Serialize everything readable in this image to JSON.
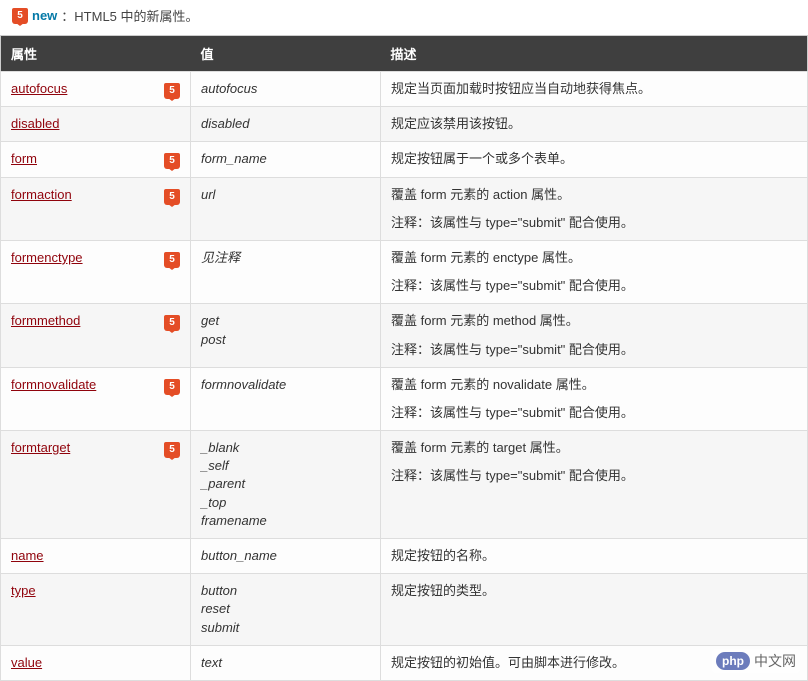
{
  "legend": {
    "badge_glyph": "5",
    "new_label": "new",
    "text": "：HTML5 中的新属性。"
  },
  "table": {
    "headers": {
      "attr": "属性",
      "val": "值",
      "desc": "描述"
    },
    "rows": [
      {
        "attr": "autofocus",
        "is_html5": true,
        "values": [
          "autofocus"
        ],
        "desc": [
          "规定当页面加载时按钮应当自动地获得焦点。"
        ]
      },
      {
        "attr": "disabled",
        "is_html5": false,
        "values": [
          "disabled"
        ],
        "desc": [
          "规定应该禁用该按钮。"
        ]
      },
      {
        "attr": "form",
        "is_html5": true,
        "values": [
          "form_name"
        ],
        "desc": [
          "规定按钮属于一个或多个表单。"
        ]
      },
      {
        "attr": "formaction",
        "is_html5": true,
        "values": [
          "url"
        ],
        "desc": [
          "覆盖 form 元素的 action 属性。",
          "注释：该属性与 type=\"submit\" 配合使用。"
        ]
      },
      {
        "attr": "formenctype",
        "is_html5": true,
        "values": [
          "见注释"
        ],
        "desc": [
          "覆盖 form 元素的 enctype 属性。",
          "注释：该属性与 type=\"submit\" 配合使用。"
        ]
      },
      {
        "attr": "formmethod",
        "is_html5": true,
        "values": [
          "get",
          "post"
        ],
        "desc": [
          "覆盖 form 元素的 method 属性。",
          "注释：该属性与 type=\"submit\" 配合使用。"
        ]
      },
      {
        "attr": "formnovalidate",
        "is_html5": true,
        "values": [
          "formnovalidate"
        ],
        "desc": [
          "覆盖 form 元素的 novalidate 属性。",
          "注释：该属性与 type=\"submit\" 配合使用。"
        ]
      },
      {
        "attr": "formtarget",
        "is_html5": true,
        "values": [
          "_blank",
          "_self",
          "_parent",
          "_top",
          "framename"
        ],
        "desc": [
          "覆盖 form 元素的 target 属性。",
          "注释：该属性与 type=\"submit\" 配合使用。"
        ]
      },
      {
        "attr": "name",
        "is_html5": false,
        "values": [
          "button_name"
        ],
        "desc": [
          "规定按钮的名称。"
        ]
      },
      {
        "attr": "type",
        "is_html5": false,
        "values": [
          "button",
          "reset",
          "submit"
        ],
        "desc": [
          "规定按钮的类型。"
        ]
      },
      {
        "attr": "value",
        "is_html5": false,
        "values": [
          "text"
        ],
        "desc": [
          "规定按钮的初始值。可由脚本进行修改。"
        ]
      }
    ]
  },
  "watermark": {
    "php": "php",
    "site": "中文网"
  }
}
